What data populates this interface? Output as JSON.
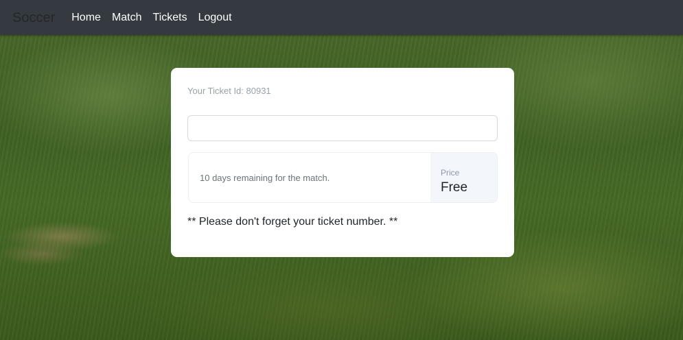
{
  "navbar": {
    "brand": "Soccer",
    "links": [
      "Home",
      "Match",
      "Tickets",
      "Logout"
    ]
  },
  "ticket": {
    "id_text": "Your Ticket Id: 80931",
    "input_value": "",
    "remaining_text": "10 days remaining for the match.",
    "price_label": "Price",
    "price_value": "Free",
    "reminder": "** Please don't forget your ticket number. **"
  },
  "colors": {
    "navbar_bg": "#343a40",
    "card_bg": "#ffffff",
    "price_bg": "#f3f6fb"
  }
}
